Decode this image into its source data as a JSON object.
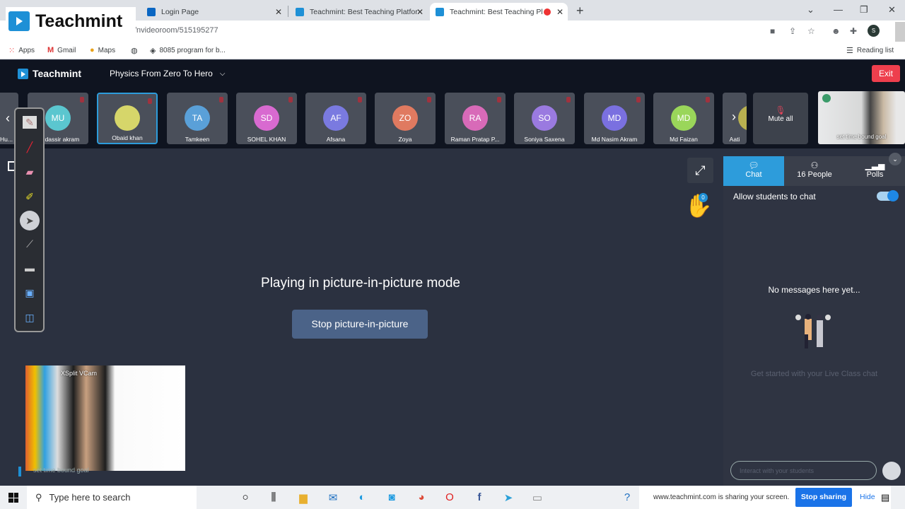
{
  "browser": {
    "tabs": [
      {
        "label": "",
        "favicon": "teachmint-icon"
      },
      {
        "label": "Login Page",
        "favicon": "linkedin-icon"
      },
      {
        "label": "Teachmint: Best Teaching Platfor",
        "favicon": "teachmint-icon"
      },
      {
        "label": "Teachmint: Best Teaching Pl",
        "favicon": "teachmint-icon",
        "recording": true,
        "active": true
      }
    ],
    "new_tab": "+",
    "url": "/nvideoroom/515195277",
    "bookmarks": [
      {
        "label": "Apps",
        "icon": "apps-icon"
      },
      {
        "label": "Gmail",
        "icon": "gmail-icon"
      },
      {
        "label": "Maps",
        "icon": "maps-icon"
      },
      {
        "label": "",
        "icon": "globe-icon"
      },
      {
        "label": "8085 program for b...",
        "icon": "bookmark-icon"
      }
    ],
    "reading_list": "Reading list",
    "profile_initial": "S",
    "watermark": "Teachmint"
  },
  "app": {
    "brand": "Teachmint",
    "course": "Physics From Zero To Hero",
    "exit_label": "Exit",
    "participants": [
      {
        "initials": "",
        "name": "Hu...",
        "color": "#555a66"
      },
      {
        "initials": "MU",
        "name": "Mudassir akram",
        "color": "#5bc6cf"
      },
      {
        "initials": "",
        "name": "Obaid khan",
        "color": "#d6d66a",
        "selected": true
      },
      {
        "initials": "TA",
        "name": "Tamkeen",
        "color": "#5aa0d8"
      },
      {
        "initials": "SD",
        "name": "SOHEL KHAN",
        "color": "#d86ad0"
      },
      {
        "initials": "AF",
        "name": "Afsana",
        "color": "#7a7ae0"
      },
      {
        "initials": "ZO",
        "name": "Zoya",
        "color": "#e07a60"
      },
      {
        "initials": "RA",
        "name": "Raman Pratap P...",
        "color": "#d86ab8"
      },
      {
        "initials": "SO",
        "name": "Soniya Saxena",
        "color": "#9a7ae0"
      },
      {
        "initials": "MD",
        "name": "Md Nasim Akram",
        "color": "#7a70e0"
      },
      {
        "initials": "MD",
        "name": "Md Faizan",
        "color": "#9ad65a"
      },
      {
        "initials": "",
        "name": "Aati",
        "color": "#b8b050"
      }
    ],
    "mute_all": "Mute all",
    "teacher_cam_caption": "set time bound goal",
    "pip_message": "Playing in picture-in-picture mode",
    "pip_button": "Stop picture-in-picture",
    "raised_hands": "0",
    "self_cam_label": "XSplit VCam",
    "self_cam_caption": "set time bound goal",
    "tools": [
      "whiteboard-icon",
      "pen-icon",
      "eraser-icon",
      "highlighter-icon",
      "cursor-icon",
      "line-icon",
      "keyboard-icon",
      "screen-icon",
      "share-screen-icon"
    ]
  },
  "side_panel": {
    "tabs": [
      {
        "label": "Chat",
        "icon": "chat-icon",
        "active": true
      },
      {
        "label": "16 People",
        "icon": "people-icon"
      },
      {
        "label": "Polls",
        "icon": "polls-icon"
      }
    ],
    "allow_chat_label": "Allow students to chat",
    "allow_chat": true,
    "empty_title": "No messages here yet...",
    "empty_sub": "Get started with your Live Class chat",
    "input_placeholder": "Interact with your students"
  },
  "taskbar": {
    "search_placeholder": "Type here to search",
    "share_message": "www.teachmint.com is sharing your screen.",
    "stop_sharing": "Stop sharing",
    "hide": "Hide"
  }
}
